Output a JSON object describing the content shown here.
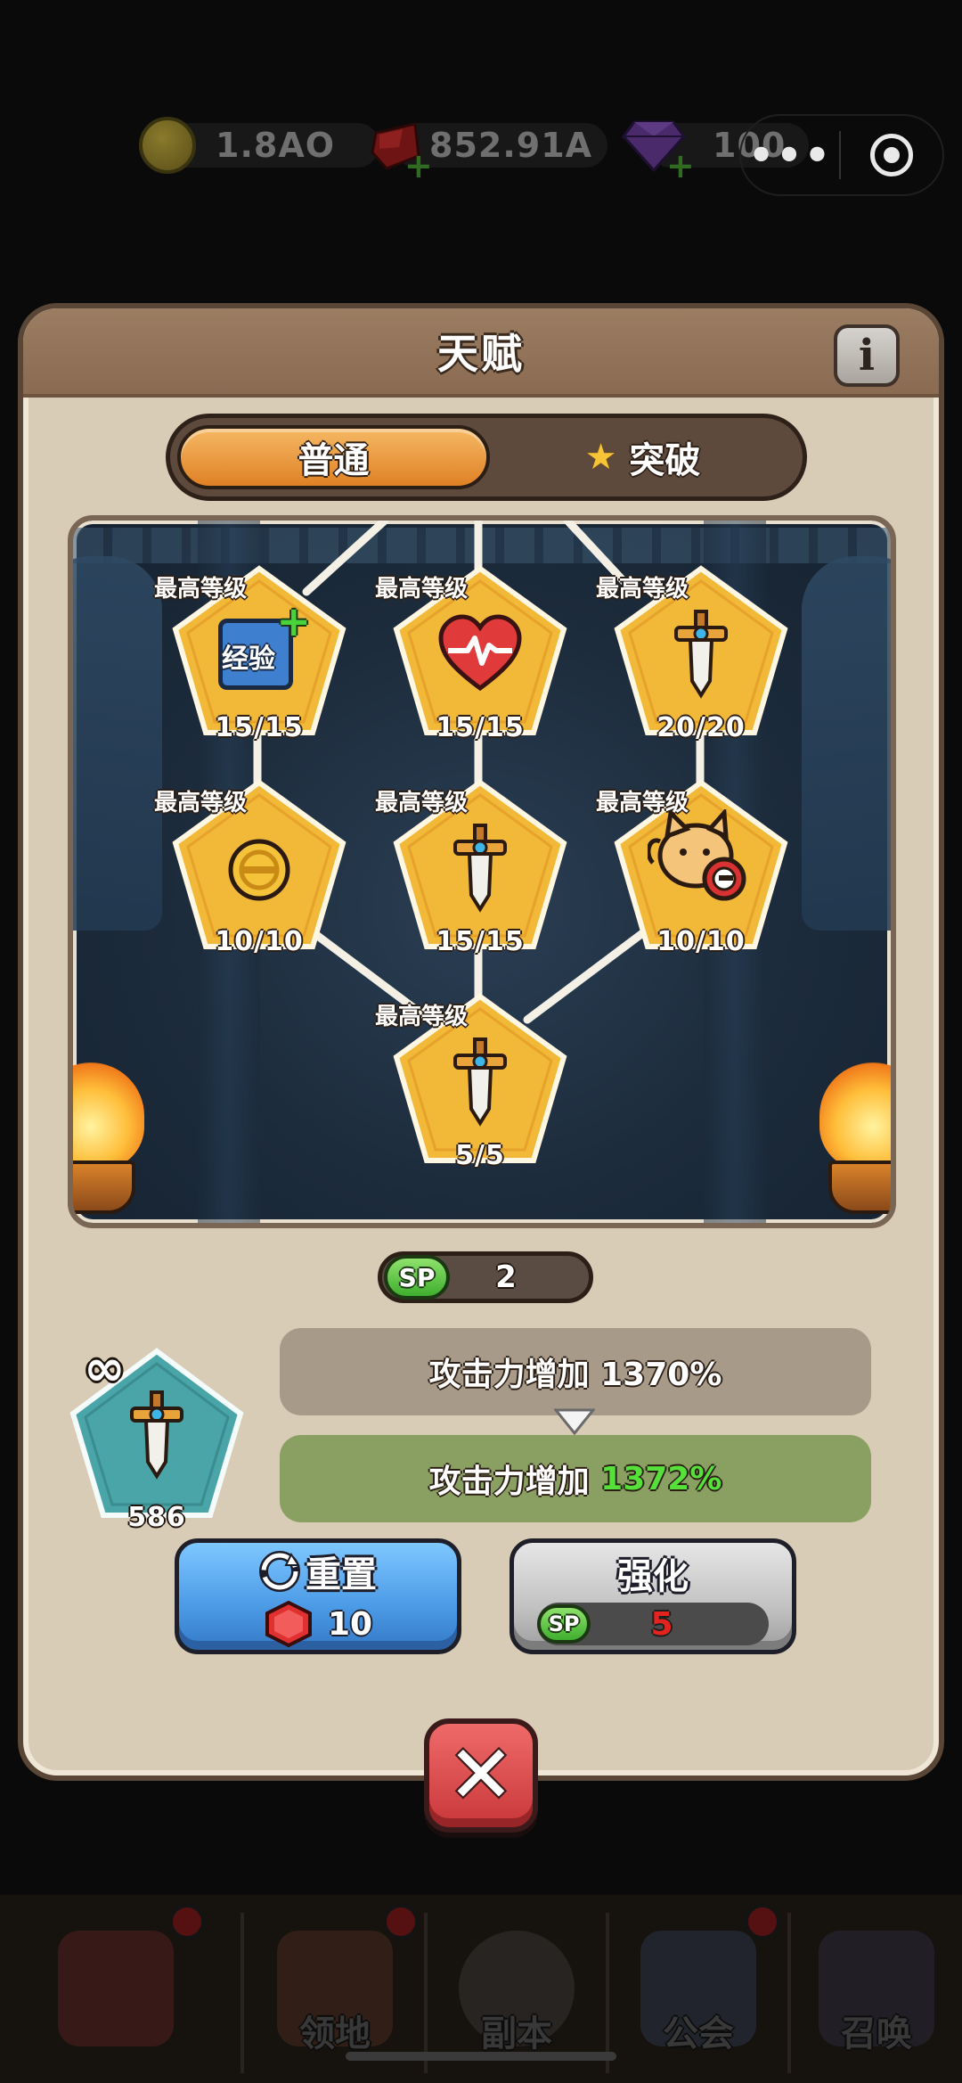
{
  "resources": {
    "gold": "1.8AO",
    "ruby": "852.91A",
    "gem": "100"
  },
  "capsule": {
    "more": "•••"
  },
  "panel": {
    "title": "天赋",
    "info_glyph": "i",
    "tabs": [
      {
        "label": "普通",
        "active": true
      },
      {
        "label": "突破",
        "active": false,
        "icon": "star-icon"
      }
    ]
  },
  "talents": [
    {
      "caption": "最高等级",
      "level": "15/15",
      "icon": "exp-book-icon",
      "icon_text": "经验",
      "icon_plus": "+"
    },
    {
      "caption": "最高等级",
      "level": "15/15",
      "icon": "heart-icon"
    },
    {
      "caption": "最高等级",
      "level": "20/20",
      "icon": "sword-icon"
    },
    {
      "caption": "最高等级",
      "level": "10/10",
      "icon": "coin-icon"
    },
    {
      "caption": "最高等级",
      "level": "15/15",
      "icon": "sword-icon"
    },
    {
      "caption": "最高等级",
      "level": "10/10",
      "icon": "cat-shield-icon"
    },
    {
      "caption": "最高等级",
      "level": "5/5",
      "icon": "sword-icon"
    }
  ],
  "sp": {
    "badge": "SP",
    "value": "2"
  },
  "selected": {
    "infinity": "∞",
    "count": "586",
    "icon": "sword-icon",
    "current_text": "攻击力增加 1370%",
    "next_prefix": "攻击力增加 ",
    "next_value": "1372%"
  },
  "buttons": {
    "reset": {
      "label": "重置",
      "cost": "10",
      "cost_icon": "ruby-icon"
    },
    "upgrade": {
      "label": "强化",
      "cost": "5",
      "cost_badge": "SP"
    }
  },
  "close_glyph": "✕",
  "bottom_nav": [
    {
      "label": "",
      "icon": "close-icon"
    },
    {
      "label": "领地",
      "icon": "territory-icon"
    },
    {
      "label": "副本",
      "icon": "dungeon-icon"
    },
    {
      "label": "公会",
      "icon": "guild-icon"
    },
    {
      "label": "召唤",
      "icon": "summon-icon"
    }
  ],
  "colors": {
    "panel": "#d9ccb6",
    "tab_active": "#df8125",
    "talent_gold": "#f2b838",
    "selected_teal": "#4aa5a8",
    "highlight_green": "#56e03a",
    "reset_blue": "#4b9ae6",
    "upgrade_gray": "#c2c2c2",
    "close_red": "#c8373a"
  }
}
